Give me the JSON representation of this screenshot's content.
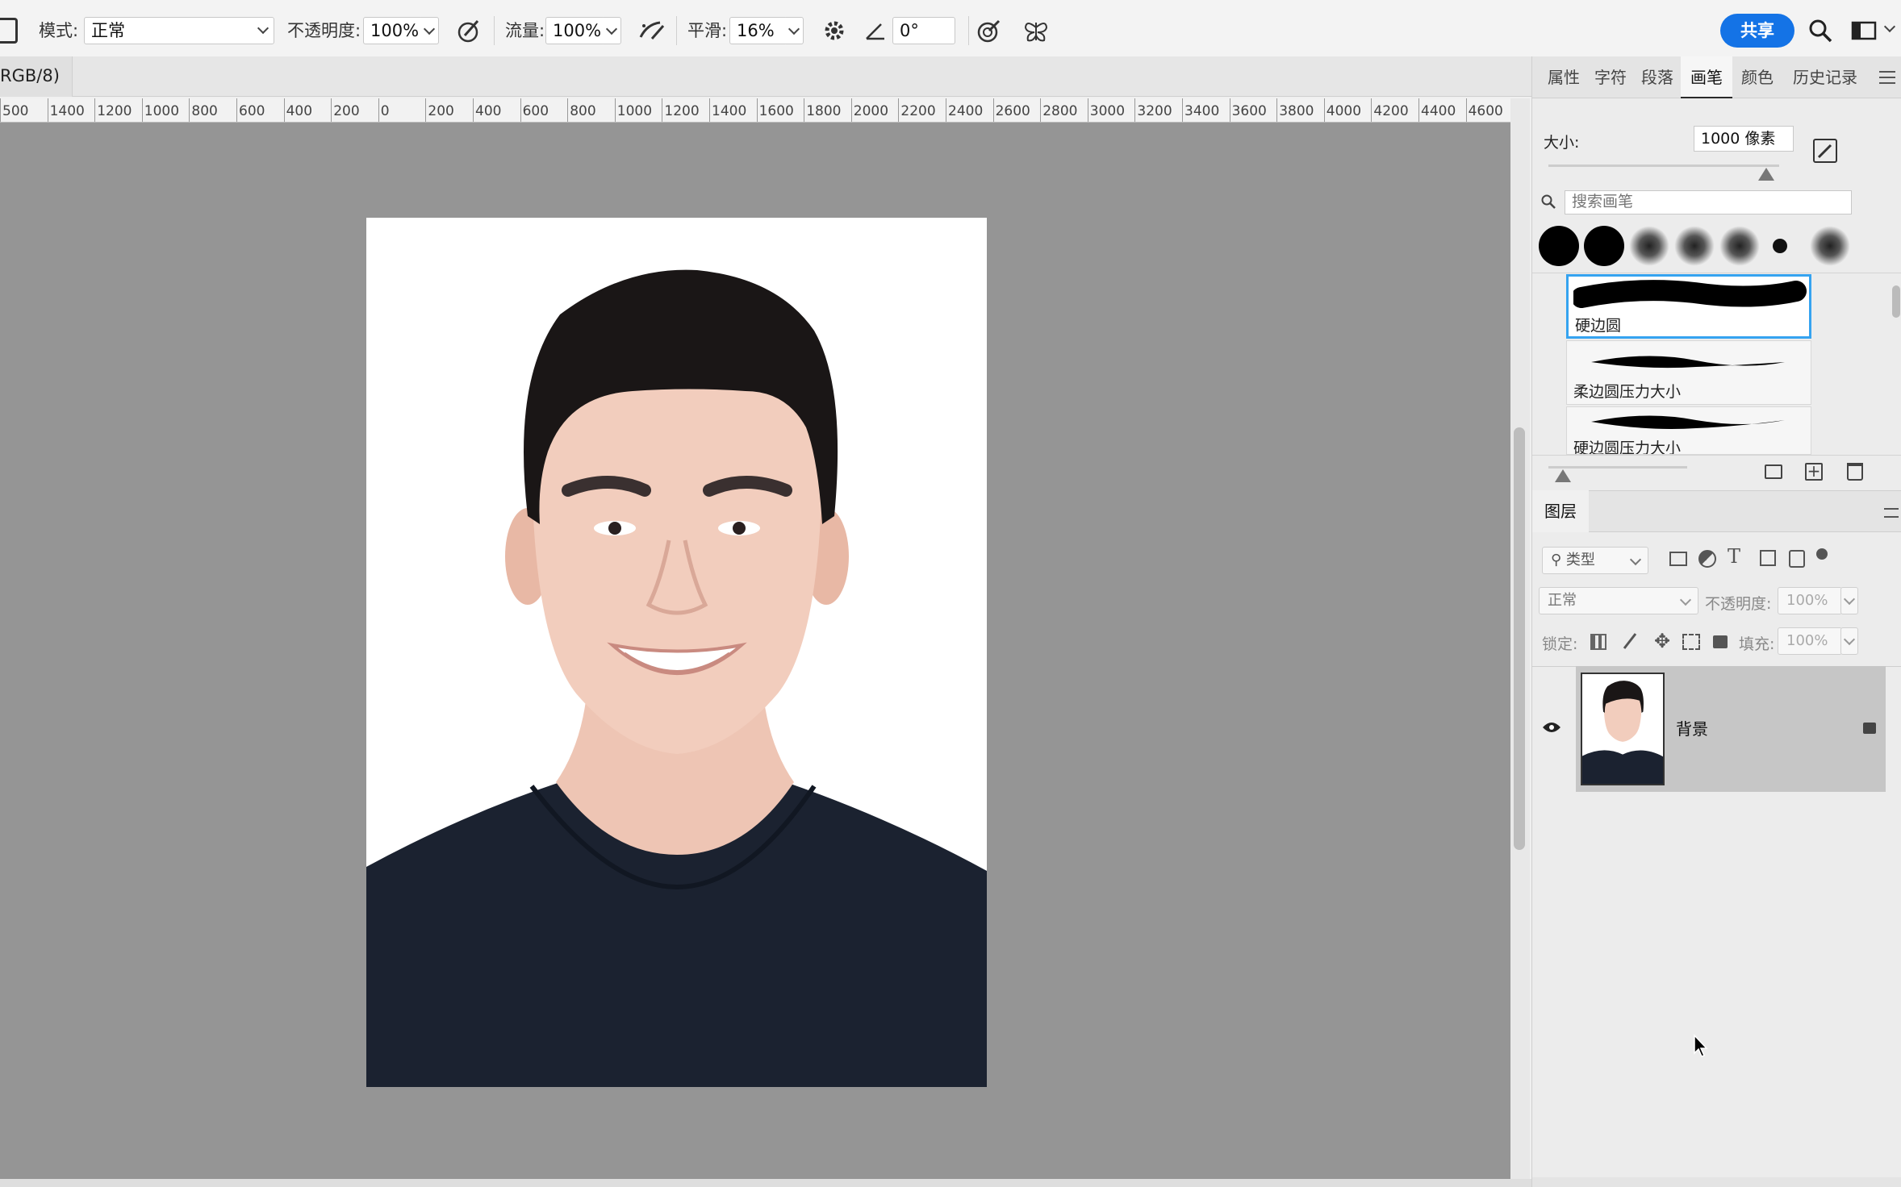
{
  "options_bar": {
    "mode_label": "模式:",
    "mode_value": "正常",
    "opacity_label": "不透明度:",
    "opacity_value": "100%",
    "flow_label": "流量:",
    "flow_value": "100%",
    "smoothing_label": "平滑:",
    "smoothing_value": "16%",
    "angle_value": "0°",
    "share_label": "共享"
  },
  "document": {
    "tab_label": "RGB/8)"
  },
  "ruler": {
    "labels": [
      "500",
      "1400",
      "1200",
      "1000",
      "800",
      "600",
      "400",
      "200",
      "0",
      "200",
      "400",
      "600",
      "800",
      "1000",
      "1200",
      "1400",
      "1600",
      "1800",
      "2000",
      "2200",
      "2400",
      "2600",
      "2800",
      "3000",
      "3200",
      "3400",
      "3600",
      "3800",
      "4000",
      "4200",
      "4400",
      "4600"
    ]
  },
  "brush_panel": {
    "tabs": [
      "属性",
      "字符",
      "段落",
      "画笔",
      "颜色",
      "历史记录"
    ],
    "active_tab": "画笔",
    "size_label": "大小:",
    "size_value": "1000 像素",
    "search_placeholder": "搜索画笔",
    "presets": [
      {
        "name": "硬边圆"
      },
      {
        "name": "柔边圆压力大小"
      },
      {
        "name": "硬边圆压力大小"
      }
    ]
  },
  "layers_panel": {
    "title": "图层",
    "filter_label": "类型",
    "blend_mode": "正常",
    "opacity_label": "不透明度:",
    "opacity_value": "100%",
    "lock_label": "锁定:",
    "fill_label": "填充:",
    "fill_value": "100%",
    "layers": [
      {
        "name": "背景",
        "visible": true,
        "locked": true
      }
    ]
  },
  "colors": {
    "accent": "#1473e6",
    "canvas_bg": "#959595",
    "shirt": "#1b2230"
  }
}
